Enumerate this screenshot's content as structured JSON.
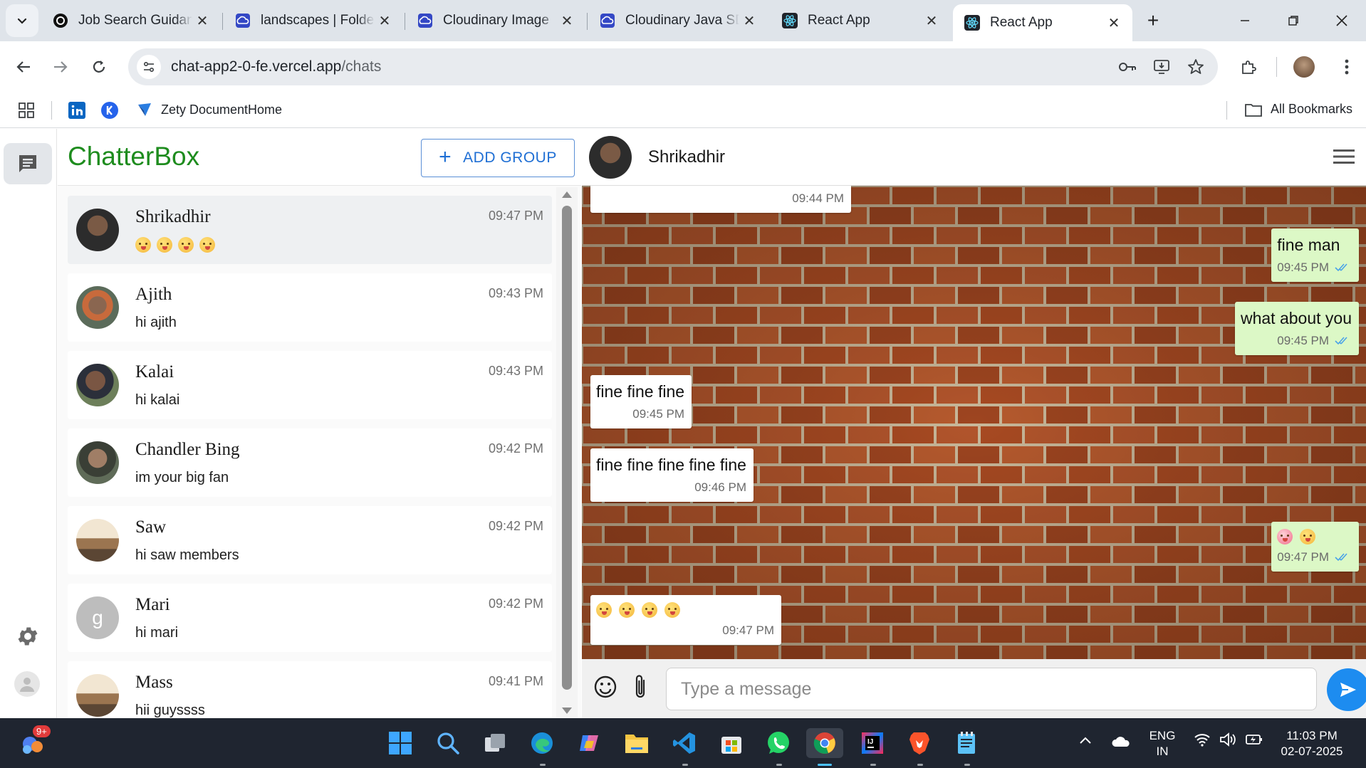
{
  "browser": {
    "tabs": [
      {
        "title": "Job Search Guidan",
        "icon": "openai-icon"
      },
      {
        "title": "landscapes | Folde",
        "icon": "cloudinary-icon"
      },
      {
        "title": "Cloudinary Image",
        "icon": "cloudinary-icon"
      },
      {
        "title": "Cloudinary Java SD",
        "icon": "cloudinary-icon"
      },
      {
        "title": "React App",
        "icon": "react-icon"
      },
      {
        "title": "React App",
        "icon": "react-icon",
        "active": true
      }
    ],
    "url_host": "chat-app2-0-fe.vercel.app",
    "url_path": "/chats",
    "bookmarks": [
      {
        "label": "",
        "icon": "linkedin-icon"
      },
      {
        "label": "",
        "icon": "k-circle-icon"
      },
      {
        "label": "Zety DocumentHome",
        "icon": "zety-icon"
      }
    ],
    "all_bookmarks": "All Bookmarks"
  },
  "app": {
    "brand": "ChatterBox",
    "add_group_label": "ADD GROUP",
    "chats": [
      {
        "name": "Shrikadhir",
        "preview": "",
        "preview_emojis": 4,
        "time": "09:47 PM",
        "selected": true
      },
      {
        "name": "Ajith",
        "preview": "hi ajith",
        "time": "09:43 PM"
      },
      {
        "name": "Kalai",
        "preview": "hi kalai",
        "time": "09:43 PM"
      },
      {
        "name": "Chandler Bing",
        "preview": "im your big fan",
        "time": "09:42 PM"
      },
      {
        "name": "Saw",
        "preview": "hi saw members",
        "time": "09:42 PM"
      },
      {
        "name": "Mari",
        "preview": "hi mari",
        "time": "09:42 PM",
        "avatar_letter": "g"
      },
      {
        "name": "Mass",
        "preview": "hii guyssss",
        "time": "09:41 PM"
      }
    ],
    "conversation": {
      "contact": "Shrikadhir",
      "messages": [
        {
          "dir": "in",
          "text": "",
          "time": "09:44 PM"
        },
        {
          "dir": "out",
          "text": "fine man",
          "time": "09:45 PM",
          "read": true
        },
        {
          "dir": "out",
          "text": "what about you",
          "time": "09:45 PM",
          "read": true
        },
        {
          "dir": "in",
          "text": "fine fine fine",
          "time": "09:45 PM"
        },
        {
          "dir": "in",
          "text": "fine fine fine fine fine",
          "time": "09:46 PM"
        },
        {
          "dir": "out",
          "text": "",
          "emojis": 2,
          "time": "09:47 PM",
          "read": true
        },
        {
          "dir": "in",
          "text": "",
          "emojis": 4,
          "time": "09:47 PM"
        }
      ],
      "input_placeholder": "Type a message"
    }
  },
  "taskbar": {
    "notification_badge": "9+",
    "lang": "ENG",
    "region": "IN",
    "time": "11:03 PM",
    "date": "02-07-2025"
  },
  "colors": {
    "brand_green": "#1e8c1e",
    "accent_blue": "#1f6fd4",
    "outgoing_bubble": "#dcf8c6",
    "send_button": "#1d8cf0"
  }
}
